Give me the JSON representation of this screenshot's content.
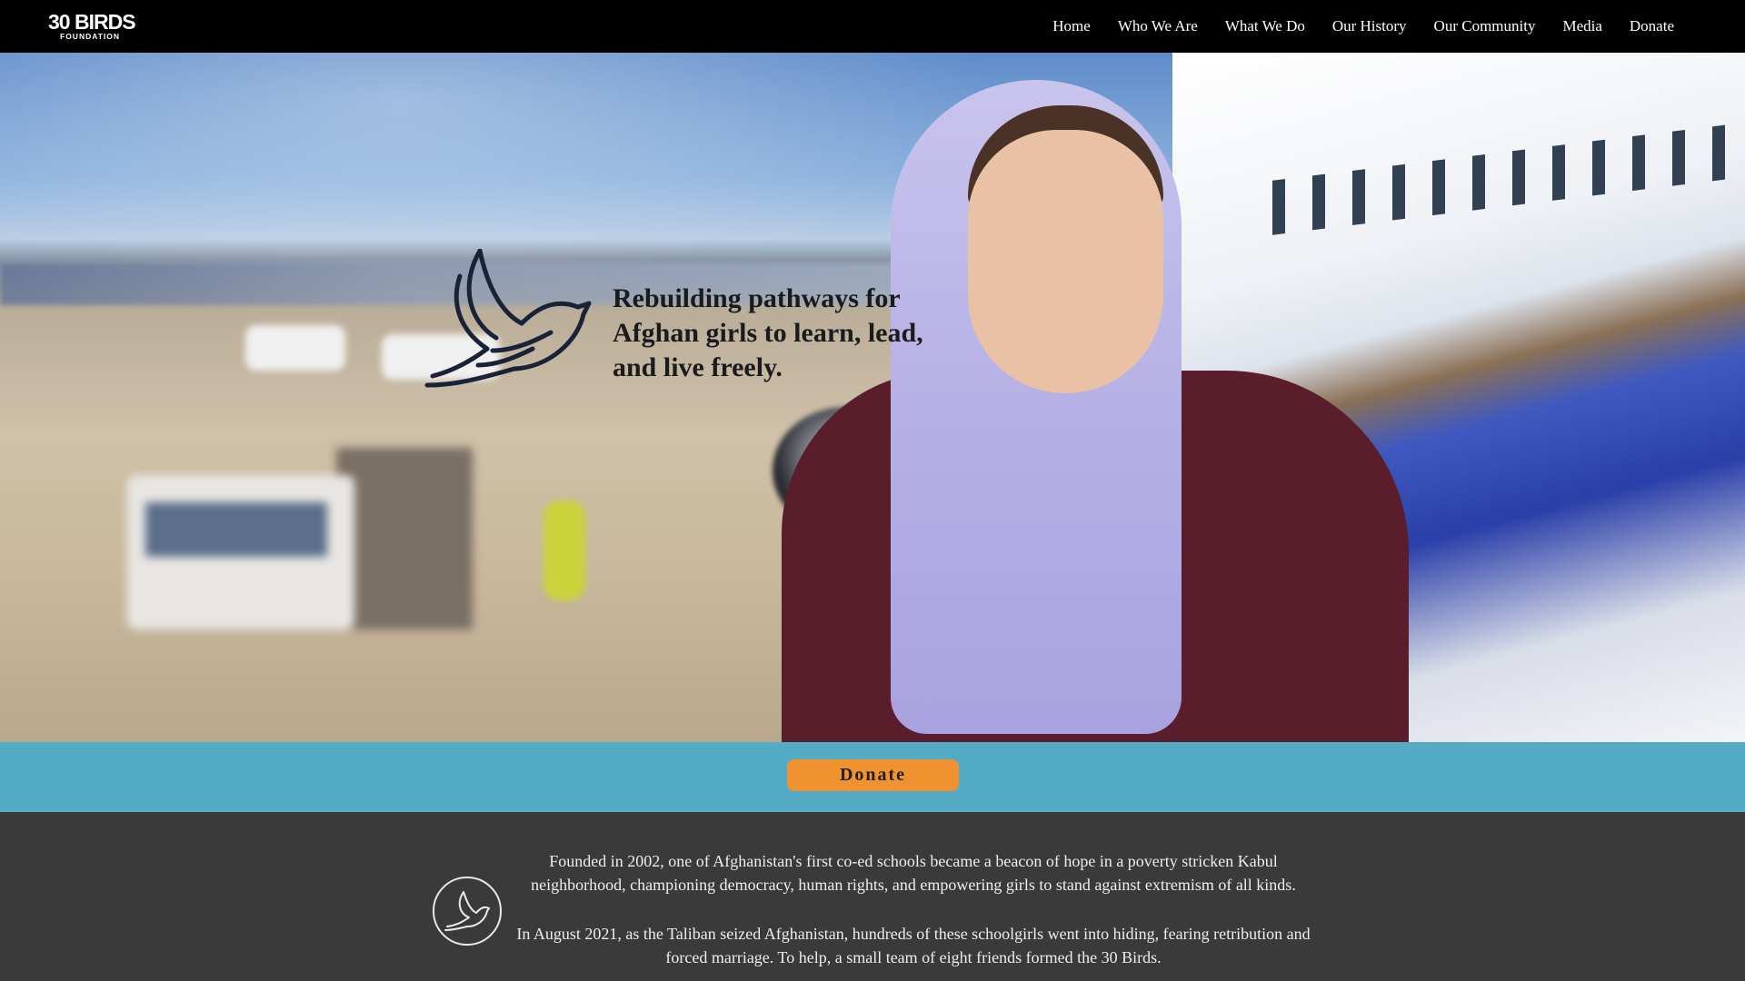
{
  "brand": {
    "logo_main": "30 BIRDS",
    "logo_sub": "FOUNDATION"
  },
  "nav": {
    "items": [
      {
        "label": "Home"
      },
      {
        "label": "Who We Are"
      },
      {
        "label": "What We Do"
      },
      {
        "label": "Our History"
      },
      {
        "label": "Our Community"
      },
      {
        "label": "Media"
      },
      {
        "label": "Donate"
      }
    ]
  },
  "hero": {
    "title_line1": "Rebuilding pathways for",
    "title_line2": "Afghan girls to learn, lead,",
    "title_line3": "and live freely.",
    "bird_icon": "phoenix-bird-icon"
  },
  "cta": {
    "donate_label": "Donate",
    "band_color": "#54abc5",
    "button_color": "#f0922f"
  },
  "about": {
    "badge_icon": "bird-badge-icon",
    "paragraph1": "Founded in 2002, one of Afghanistan's first co-ed schools became a beacon of hope in a poverty stricken Kabul neighborhood, championing democracy, human rights, and empowering girls to stand against extremism of all kinds.",
    "paragraph2": "In August 2021, as the Taliban seized Afghanistan, hundreds of these schoolgirls went into hiding, fearing retribution and forced marriage. To help, a small team of eight friends formed the 30 Birds."
  }
}
